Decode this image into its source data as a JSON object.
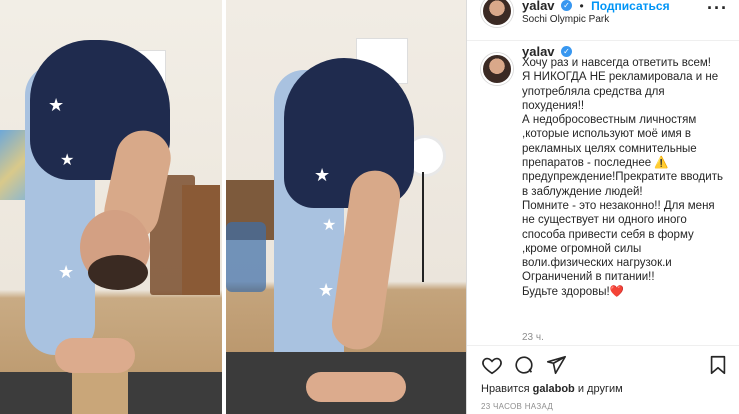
{
  "post": {
    "username": "yalav",
    "follow_label": "Подписаться",
    "separator": "•",
    "location": "Sochi Olympic Park",
    "more_icon": "more-horizontal-icon"
  },
  "caption": {
    "username": "yalav",
    "text": "Хочу раз и навсегда ответить всем!\nЯ НИКОГДА НЕ рекламировала и не употребляла средства для похудения!!\nА недобросовестным личностям ,которые используют моё имя в рекламных целях сомнительные препаратов - последнее ⚠️ предупреждение!Прекратите вводить в заблуждение людей!\nПомните - это незаконно!! Для меня не существует ни одного иного способа привести себя в форму ,кроме огромной силы воли.физических нагрузок.и Ограничений в питании!!\nБудьте здоровы!❤️",
    "time": "23 ч."
  },
  "actions": {
    "like_icon": "heart-icon",
    "comment_icon": "comment-icon",
    "share_icon": "send-icon",
    "save_icon": "bookmark-icon"
  },
  "likes": {
    "prefix": "Нравится",
    "user": "galabob",
    "suffix": "и другим"
  },
  "timestamp": "23 ЧАСОВ НАЗАД",
  "colors": {
    "accent": "#0095f6",
    "verified": "#3897f0",
    "border": "#dbdbdb",
    "muted": "#8e8e8e"
  }
}
